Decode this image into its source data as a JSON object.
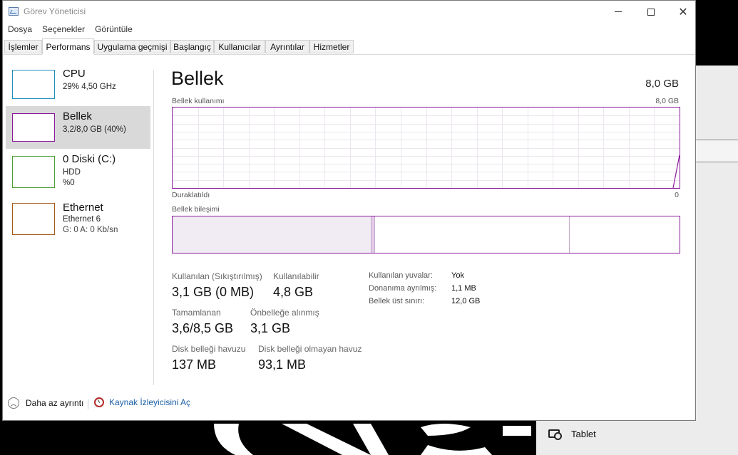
{
  "window": {
    "title": "Görev Yöneticisi"
  },
  "menu": [
    "Dosya",
    "Seçenekler",
    "Görüntüle"
  ],
  "tabs": [
    {
      "label": "İşlemler",
      "active": false
    },
    {
      "label": "Performans",
      "active": true
    },
    {
      "label": "Uygulama geçmişi",
      "active": false
    },
    {
      "label": "Başlangıç",
      "active": false
    },
    {
      "label": "Kullanıcılar",
      "active": false
    },
    {
      "label": "Ayrıntılar",
      "active": false
    },
    {
      "label": "Hizmetler",
      "active": false
    }
  ],
  "perf_items": [
    {
      "name": "CPU",
      "line1": "29%  4,50 GHz",
      "line2": "",
      "color": "#1f8fbf",
      "selected": false
    },
    {
      "name": "Bellek",
      "line1": "3,2/8,0 GB (40%)",
      "line2": "",
      "color": "#8b1a9c",
      "selected": true
    },
    {
      "name": "0 Diski (C:)",
      "line1": "HDD",
      "line2": "%0",
      "color": "#4c9f38",
      "selected": false
    },
    {
      "name": "Ethernet",
      "line1": "Ethernet 6",
      "line2": "G: 0  A: 0 Kb/sn",
      "color": "#a75c1c",
      "selected": false
    }
  ],
  "main": {
    "title": "Bellek",
    "total": "8,0 GB",
    "usage_caption": "Bellek kullanımı",
    "usage_max": "8,0 GB",
    "paused_caption": "Duraklatıldı",
    "paused_value": "0",
    "composition_caption": "Bellek bileşimi"
  },
  "stats": {
    "in_use_label": "Kullanılan (Sıkıştırılmış)",
    "in_use_value": "3,1 GB (0 MB)",
    "available_label": "Kullanılabilir",
    "available_value": "4,8 GB",
    "committed_label": "Tamamlanan",
    "committed_value": "3,6/8,5 GB",
    "cached_label": "Önbelleğe alınmış",
    "cached_value": "3,1 GB",
    "paged_label": "Disk belleği havuzu",
    "paged_value": "137 MB",
    "nonpaged_label": "Disk belleği olmayan havuz",
    "nonpaged_value": "93,1 MB"
  },
  "details": [
    {
      "label": "Kullanılan yuvalar:",
      "value": "Yok"
    },
    {
      "label": "Donanıma ayrılmış:",
      "value": "1,1 MB"
    },
    {
      "label": "Bellek üst sınırı:",
      "value": "12,0 GB"
    }
  ],
  "footer": {
    "less_details": "Daha az ayrıntı",
    "resource_monitor": "Kaynak İzleyicisini Aç"
  },
  "background": {
    "tablet_label": "Tablet"
  },
  "accent_memory": "#8b1a9c"
}
